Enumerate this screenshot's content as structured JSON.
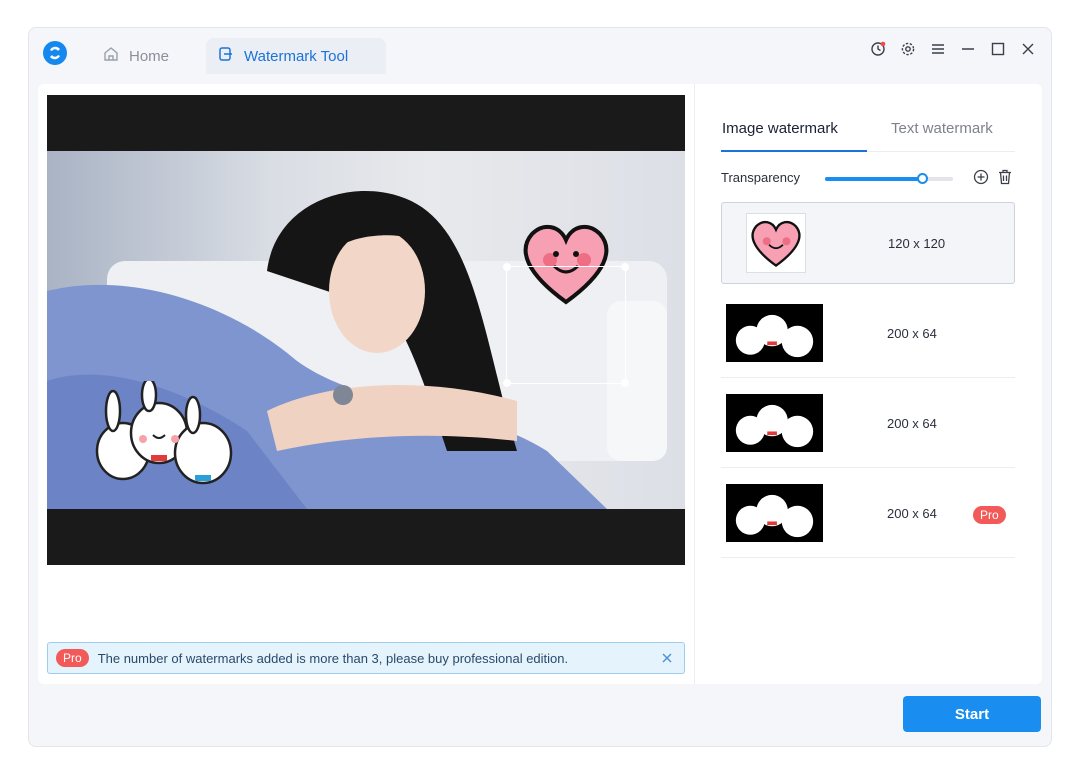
{
  "tabs": {
    "home_label": "Home",
    "watermark_label": "Watermark Tool"
  },
  "notice": {
    "badge": "Pro",
    "text": "The number of watermarks added is more than 3, please buy professional edition."
  },
  "panel": {
    "tab_image": "Image watermark",
    "tab_text": "Text watermark",
    "transparency_label": "Transparency",
    "transparency_value": 0.76
  },
  "watermarks": [
    {
      "size": "120 x 120",
      "type": "heart",
      "selected": true
    },
    {
      "size": "200 x 64",
      "type": "bunnies"
    },
    {
      "size": "200 x 64",
      "type": "bunnies"
    },
    {
      "size": "200 x 64",
      "type": "bunnies",
      "badge": "Pro"
    }
  ],
  "start_label": "Start",
  "colors": {
    "accent": "#1a8ef0",
    "pro": "#f25a5a",
    "tab_active_text": "#1a73d8"
  },
  "icons": {
    "window": [
      "clock-icon",
      "gear-icon",
      "menu-icon",
      "minimize-icon",
      "maximize-icon",
      "close-icon"
    ]
  }
}
